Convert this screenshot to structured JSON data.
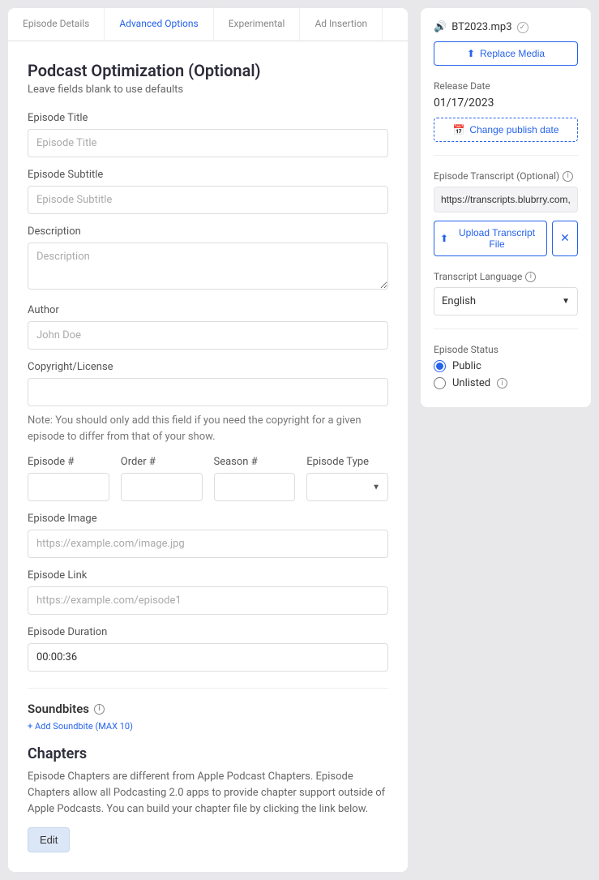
{
  "tabs": {
    "episode_details": "Episode Details",
    "advanced_options": "Advanced Options",
    "experimental": "Experimental",
    "ad_insertion": "Ad Insertion"
  },
  "main": {
    "title": "Podcast Optimization (Optional)",
    "subtitle": "Leave fields blank to use defaults",
    "fields": {
      "episode_title_label": "Episode Title",
      "episode_title_placeholder": "Episode Title",
      "episode_subtitle_label": "Episode Subtitle",
      "episode_subtitle_placeholder": "Episode Subtitle",
      "description_label": "Description",
      "description_placeholder": "Description",
      "author_label": "Author",
      "author_placeholder": "John Doe",
      "copyright_label": "Copyright/License",
      "copyright_note": "Note: You should only add this field if you need the copyright for a given episode to differ from that of your show.",
      "episode_num_label": "Episode #",
      "order_num_label": "Order #",
      "season_num_label": "Season #",
      "episode_type_label": "Episode Type",
      "episode_image_label": "Episode Image",
      "episode_image_placeholder": "https://example.com/image.jpg",
      "episode_link_label": "Episode Link",
      "episode_link_placeholder": "https://example.com/episode1",
      "episode_duration_label": "Episode Duration",
      "episode_duration_value": "00:00:36"
    },
    "soundbites": {
      "heading": "Soundbites",
      "add_link": "+ Add Soundbite (MAX 10)"
    },
    "chapters": {
      "heading": "Chapters",
      "description": "Episode Chapters are different from Apple Podcast Chapters. Episode Chapters allow all Podcasting 2.0 apps to provide chapter support outside of Apple Podcasts. You can build your chapter file by clicking the link below.",
      "edit_button": "Edit"
    }
  },
  "sidebar": {
    "media_filename": "BT2023.mp3",
    "replace_media": "Replace Media",
    "release_date_label": "Release Date",
    "release_date_value": "01/17/2023",
    "change_publish_date": "Change publish date",
    "transcript_label": "Episode Transcript (Optional)",
    "transcript_value": "https://transcripts.blubrry.com,",
    "upload_transcript": "Upload Transcript File",
    "language_label": "Transcript Language",
    "language_value": "English",
    "status_label": "Episode Status",
    "status_options": {
      "public": "Public",
      "unlisted": "Unlisted"
    }
  }
}
